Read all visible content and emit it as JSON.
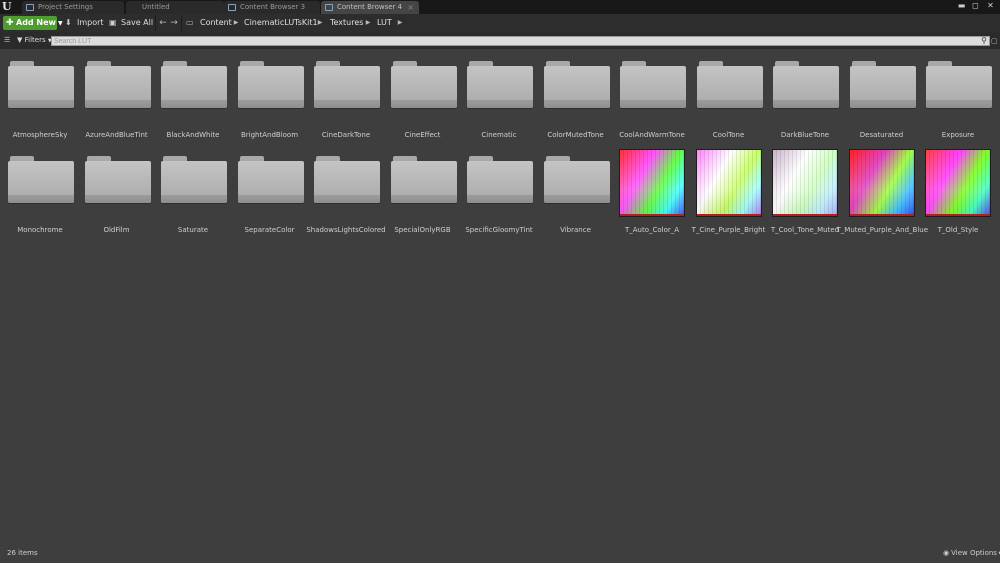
{
  "tabs": [
    {
      "label": "Project Settings",
      "active": false
    },
    {
      "label": "Untitled",
      "active": false
    },
    {
      "label": "Content Browser 3",
      "active": false
    },
    {
      "label": "Content Browser 4",
      "active": true
    }
  ],
  "window_controls": {
    "minimize": "▬",
    "maximize": "◻",
    "close": "✕"
  },
  "toolbar": {
    "add_new_label": "Add New",
    "import_label": "Import",
    "save_all_label": "Save All"
  },
  "breadcrumb": [
    "Content",
    "CinematicLUTsKit1",
    "Textures",
    "LUT"
  ],
  "filters_label": "Filters",
  "search": {
    "placeholder": "Search LUT",
    "value": ""
  },
  "folders": [
    "AtmosphereSky",
    "AzureAndBlueTint",
    "BlackAndWhite",
    "BrightAndBloom",
    "CineDarkTone",
    "CineEffect",
    "Cinematic",
    "ColorMutedTone",
    "CoolAndWarmTone",
    "CoolTone",
    "DarkBlueTone",
    "Desaturated",
    "Exposure",
    "Monochrome",
    "OldFilm",
    "Saturate",
    "SeparateColor",
    "ShadowsLightsColored",
    "SpecialOnlyRGB",
    "SpecificGloomyTint",
    "Vibrance"
  ],
  "textures": [
    {
      "name": "T_Auto_Color_A",
      "colors": [
        "#ff3030",
        "#ff50ff",
        "#60ff40",
        "#40ffff",
        "#5050ff"
      ]
    },
    {
      "name": "T_Cine_Purple_Bright",
      "colors": [
        "#ff80ff",
        "#ffffff",
        "#c8ff60",
        "#a0ffff",
        "#b080ff"
      ]
    },
    {
      "name": "T_Cool_Tone_Muted",
      "colors": [
        "#c8b0c8",
        "#ffffff",
        "#d0ffc0",
        "#c0f0ff",
        "#b0b0ff"
      ]
    },
    {
      "name": "T_Muted_Purple_And_Blue",
      "colors": [
        "#ff2020",
        "#e040c0",
        "#a0ff40",
        "#40c0ff",
        "#3050ff"
      ]
    },
    {
      "name": "T_Old_Style",
      "colors": [
        "#ff4040",
        "#ff40ff",
        "#80ff20",
        "#40ffc0",
        "#6040ff"
      ]
    }
  ],
  "status": {
    "item_count": "26 items",
    "view_options_label": "View Options"
  },
  "icons": {
    "add": "plus-icon",
    "import": "import-icon",
    "save": "save-icon",
    "search": "search-icon",
    "view": "eye-icon"
  }
}
